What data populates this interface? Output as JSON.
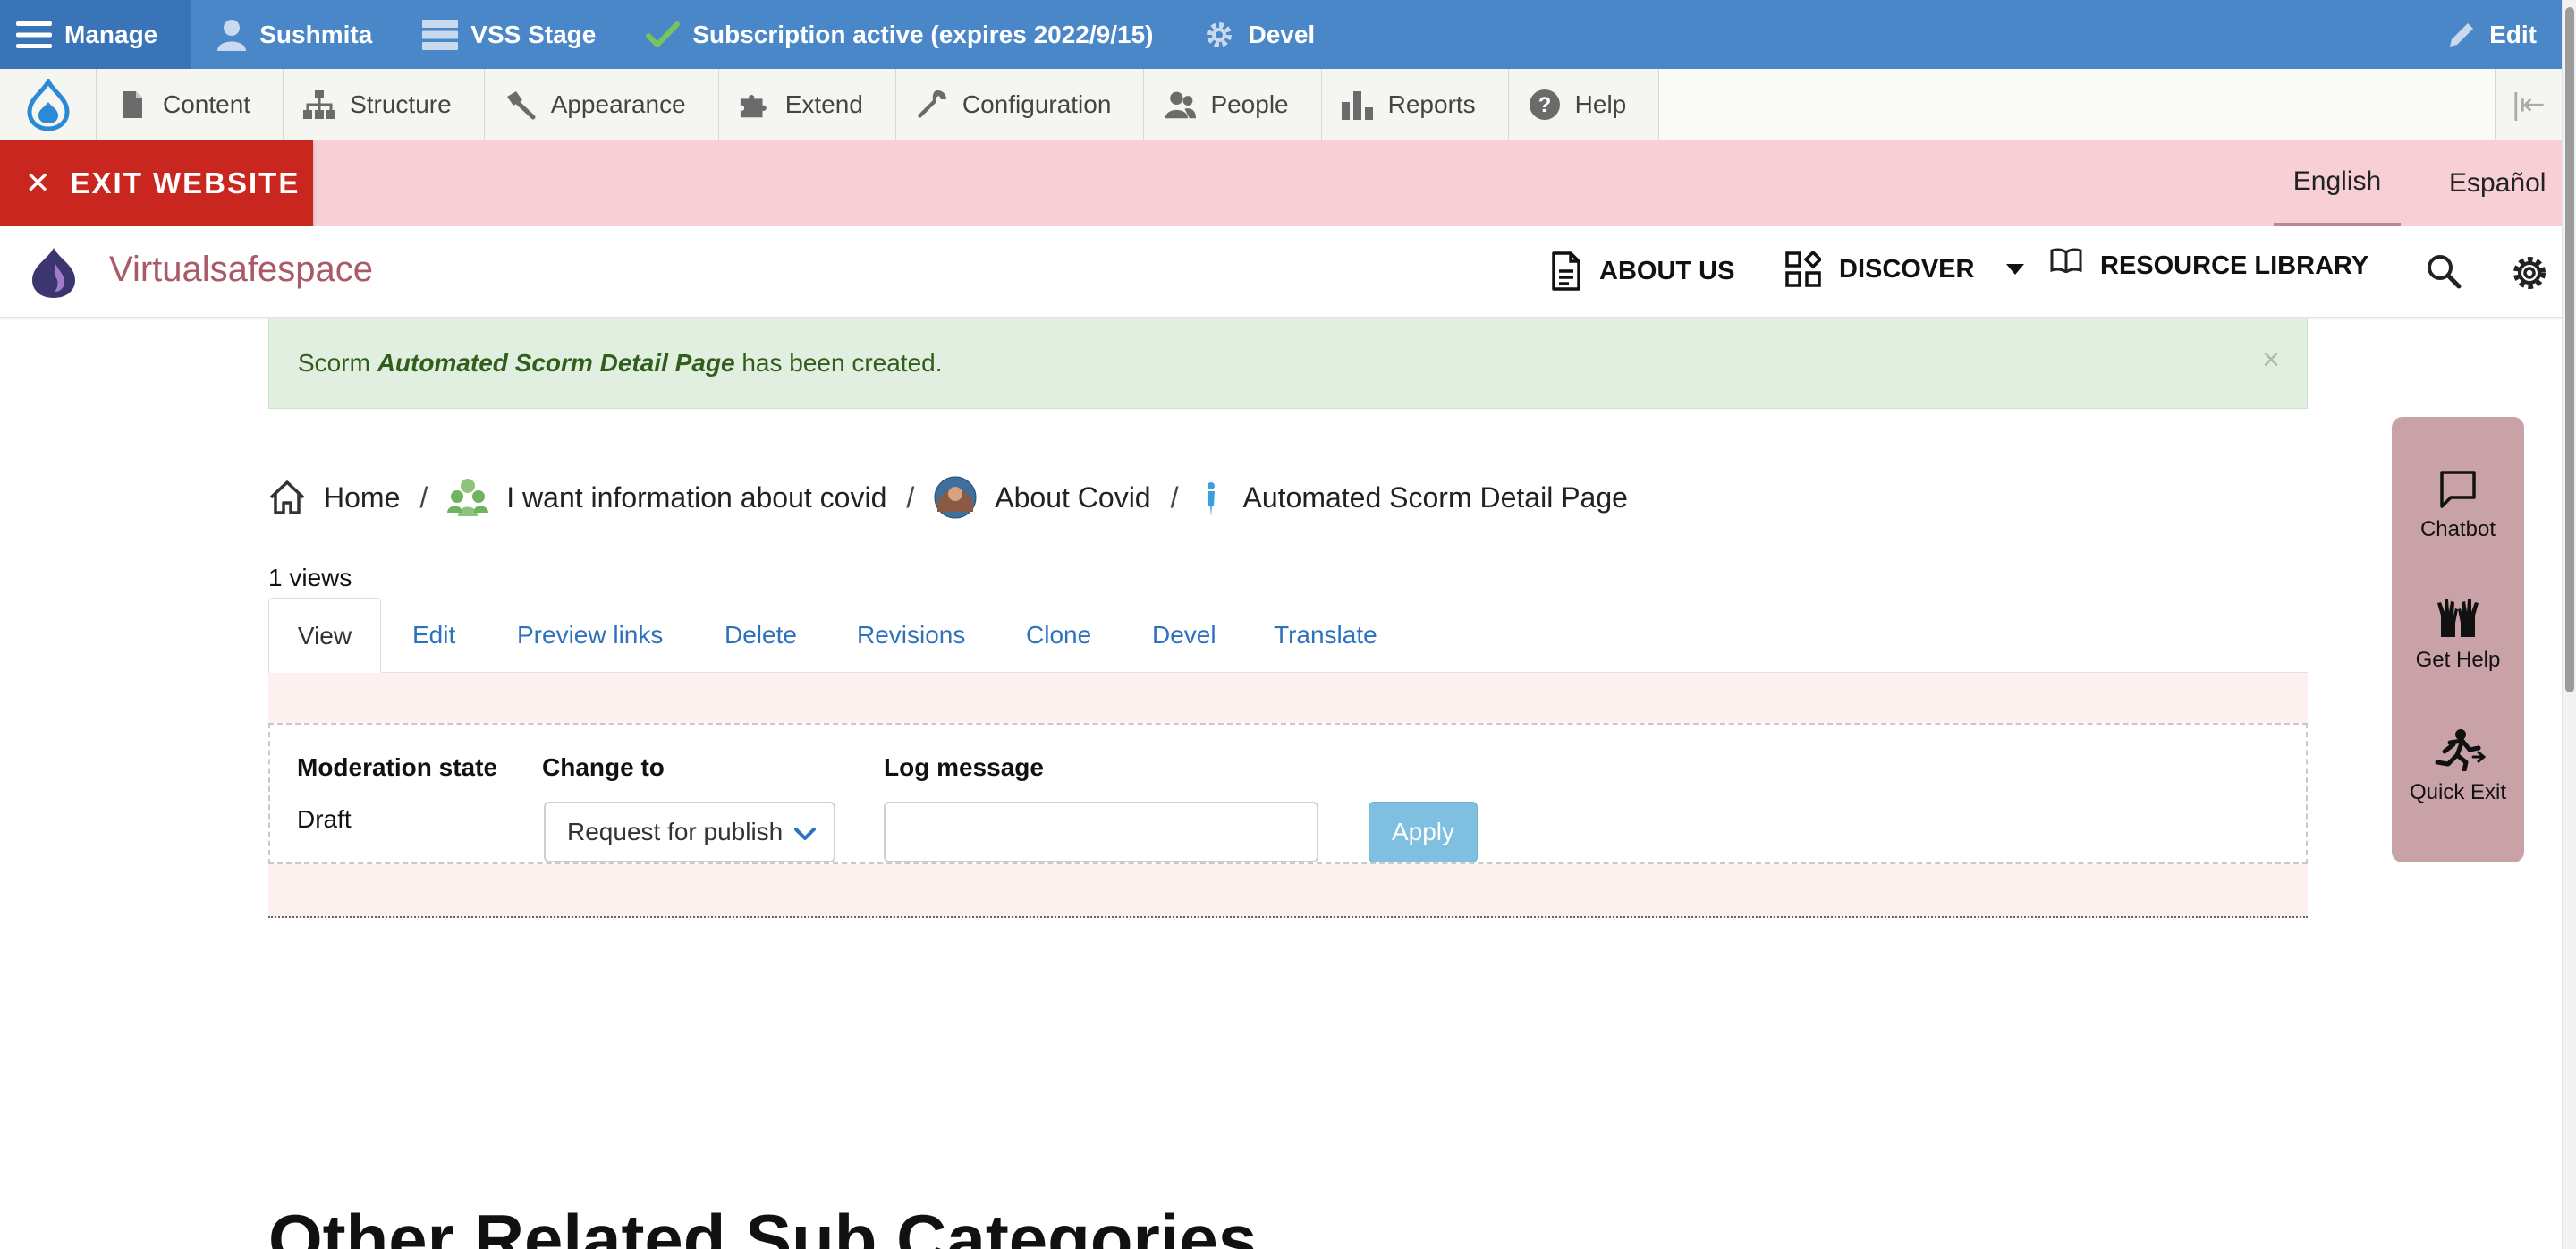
{
  "toolbar": {
    "manage": "Manage",
    "user": "Sushmita",
    "environment": "VSS Stage",
    "subscription": "Subscription active (expires 2022/9/15)",
    "devel": "Devel",
    "edit": "Edit"
  },
  "tray": {
    "items": [
      {
        "label": "Content",
        "icon": "page-icon"
      },
      {
        "label": "Structure",
        "icon": "sitemap-icon"
      },
      {
        "label": "Appearance",
        "icon": "paintbrush-icon"
      },
      {
        "label": "Extend",
        "icon": "puzzle-icon"
      },
      {
        "label": "Configuration",
        "icon": "wrench-icon"
      },
      {
        "label": "People",
        "icon": "people-icon"
      },
      {
        "label": "Reports",
        "icon": "bar-chart-icon"
      },
      {
        "label": "Help",
        "icon": "help-icon"
      }
    ]
  },
  "langbar": {
    "exit_label": "EXIT WEBSITE",
    "languages": [
      "English",
      "Español"
    ],
    "active_language": "English"
  },
  "header": {
    "site_name": "Virtualsafespace",
    "nav": {
      "about": "ABOUT US",
      "discover": "DISCOVER",
      "library": "RESOURCE LIBRARY"
    }
  },
  "status": {
    "prefix": "Scorm",
    "title": "Automated Scorm Detail Page",
    "suffix": "has been created.",
    "close": "×"
  },
  "breadcrumb": {
    "items": [
      "Home",
      "I want information about covid",
      "About Covid",
      "Automated Scorm Detail Page"
    ],
    "separator": "/"
  },
  "views": "1 views",
  "tabs": [
    "View",
    "Edit",
    "Preview links",
    "Delete",
    "Revisions",
    "Clone",
    "Devel",
    "Translate"
  ],
  "moderation": {
    "state_label": "Moderation state",
    "state_value": "Draft",
    "change_label": "Change to",
    "change_value": "Request for publish",
    "log_label": "Log message",
    "log_value": "",
    "apply": "Apply"
  },
  "related_heading": "Other Related Sub Categories",
  "widget": {
    "items": [
      "Chatbot",
      "Get Help",
      "Quick Exit"
    ]
  },
  "colors": {
    "toolbar_blue": "#4a87c9",
    "exit_red": "#c9261f",
    "langbar_pink": "#f7cfd4",
    "site_name": "#a95a67",
    "status_green_bg": "#e1efe0",
    "link_blue": "#2f72bc",
    "widget_pink": "#c9a2a8"
  }
}
